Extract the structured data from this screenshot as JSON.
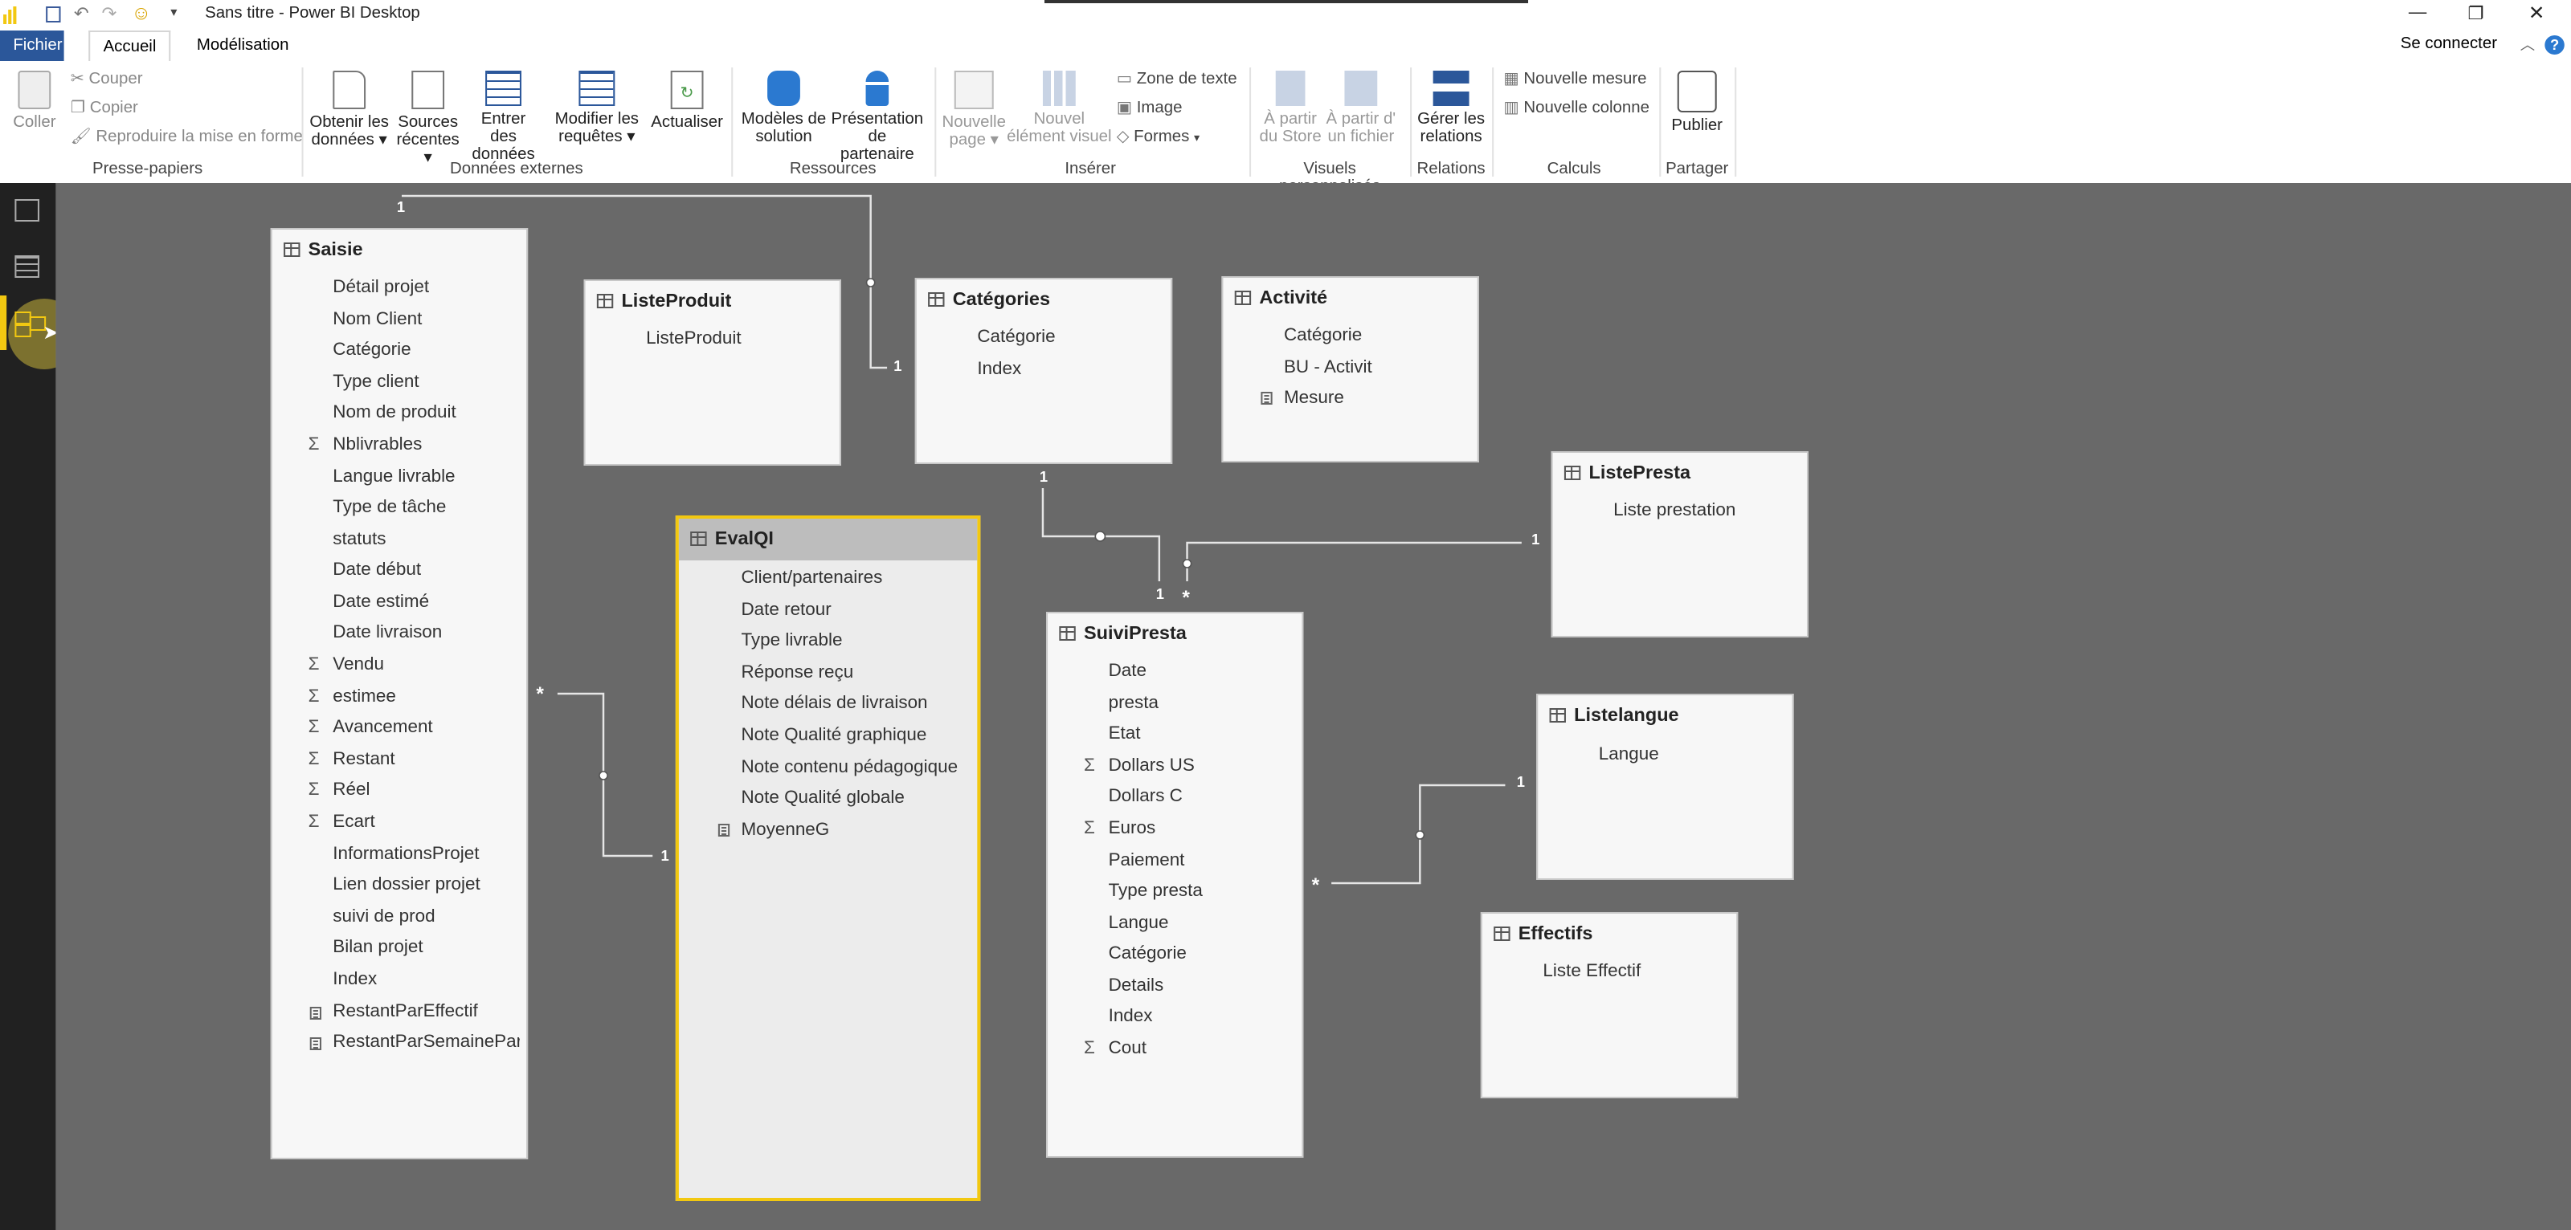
{
  "titlebar": {
    "title": "Sans titre  - Power BI Desktop",
    "sign_in": "Se connecter"
  },
  "menu": {
    "tabs": [
      "Fichier",
      "Accueil",
      "Modélisation"
    ]
  },
  "ribbon": {
    "clipboard": {
      "paste": "Coller",
      "cut": "Couper",
      "copy": "Copier",
      "format_painter": "Reproduire la mise en forme",
      "group": "Presse-papiers"
    },
    "external_data": {
      "get_data_1": "Obtenir les",
      "get_data_2": "données",
      "recent_1": "Sources",
      "recent_2": "récentes",
      "enter_1": "Entrer des",
      "enter_2": "données",
      "edit_1": "Modifier les",
      "edit_2": "requêtes",
      "refresh": "Actualiser",
      "group": "Données externes"
    },
    "resources": {
      "solutions_1": "Modèles de",
      "solutions_2": "solution",
      "partner_1": "Présentation",
      "partner_2": "de partenaire",
      "group": "Ressources"
    },
    "insert": {
      "new_page_1": "Nouvelle",
      "new_page_2": "page",
      "new_visual_1": "Nouvel",
      "new_visual_2": "élément visuel",
      "textbox": "Zone de texte",
      "image": "Image",
      "shapes": "Formes",
      "group": "Insérer"
    },
    "custom_visuals": {
      "store_1": "À partir",
      "store_2": "du Store",
      "file_1": "À partir d'",
      "file_2": "un fichier",
      "group": "Visuels personnalisés"
    },
    "relations": {
      "manage_1": "Gérer les",
      "manage_2": "relations",
      "group": "Relations"
    },
    "calcs": {
      "new_measure": "Nouvelle mesure",
      "new_column": "Nouvelle colonne",
      "group": "Calculs"
    },
    "share": {
      "publish": "Publier",
      "group": "Partager"
    }
  },
  "tables": {
    "saisie": {
      "name": "Saisie",
      "fields": [
        "Détail projet",
        "Nom Client",
        "Catégorie",
        "Type client",
        "Nom de produit",
        "Nblivrables",
        "Langue livrable",
        "Type de tâche",
        "statuts",
        "Date début",
        "Date estimé",
        "Date livraison",
        "Vendu",
        "estimee",
        "Avancement",
        "Restant",
        "Réel",
        "Ecart",
        "InformationsProjet",
        "Lien dossier projet",
        "suivi de prod",
        "Bilan projet",
        "Index",
        "RestantParEffectif",
        "RestantParSemaineParE"
      ]
    },
    "listeproduit": {
      "name": "ListeProduit",
      "fields": [
        "ListeProduit"
      ]
    },
    "categories": {
      "name": "Catégories",
      "fields": [
        "Catégorie",
        "Index"
      ]
    },
    "activite": {
      "name": "Activité",
      "fields": [
        "Catégorie",
        "BU - Activit",
        "Mesure"
      ]
    },
    "listepresta": {
      "name": "ListePresta",
      "fields": [
        "Liste prestation"
      ]
    },
    "evalqi": {
      "name": "EvalQI",
      "fields": [
        "Client/partenaires",
        "Date retour",
        "Type livrable",
        "Réponse reçu",
        "Note délais de livraison",
        "Note Qualité graphique",
        "Note contenu pédagogique",
        "Note Qualité globale",
        "MoyenneG"
      ]
    },
    "suivipresta": {
      "name": "SuiviPresta",
      "fields": [
        "Date",
        "presta",
        "Etat",
        "Dollars US",
        "Dollars C",
        "Euros",
        "Paiement",
        "Type presta",
        "Langue",
        "Catégorie",
        "Details",
        "Index",
        "Cout"
      ]
    },
    "listelangue": {
      "name": "Listelangue",
      "fields": [
        "Langue"
      ]
    },
    "effectifs": {
      "name": "Effectifs",
      "fields": [
        "Liste Effectif"
      ]
    }
  },
  "relations": {
    "one": "1",
    "many": "*"
  },
  "colors": {
    "accent": "#f2c811",
    "canvas": "#696969",
    "nav": "#212121"
  }
}
